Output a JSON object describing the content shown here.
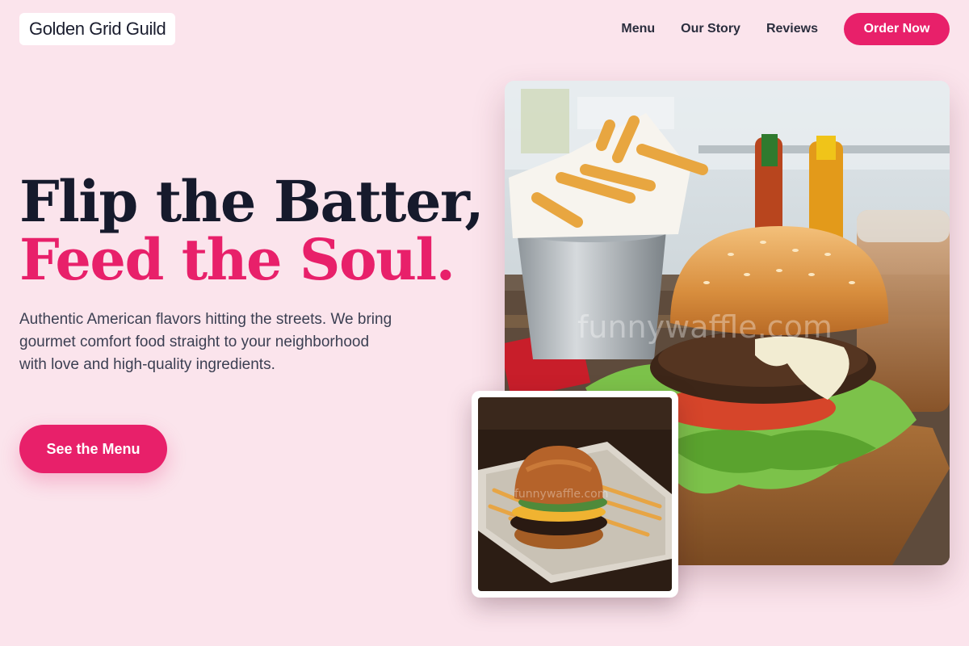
{
  "brand": {
    "name": "Golden Grid Guild"
  },
  "nav": {
    "links": [
      "Menu",
      "Our Story",
      "Reviews"
    ],
    "order_label": "Order Now"
  },
  "hero": {
    "headline_line1": "Flip the Batter,",
    "headline_line2": "Feed the Soul.",
    "subtext": "Authentic American flavors hitting the streets. We bring gourmet comfort food straight to your neighborhood with love and high-quality ingredients.",
    "cta_label": "See the Menu"
  },
  "images": {
    "main": "burger-with-fries-photo",
    "secondary": "burger-plate-photo",
    "watermark": "funnywaffle.com"
  },
  "colors": {
    "background": "#fbe4ec",
    "accent": "#e8206a",
    "heading_dark": "#161a2c",
    "body_text": "#3b3f52"
  }
}
